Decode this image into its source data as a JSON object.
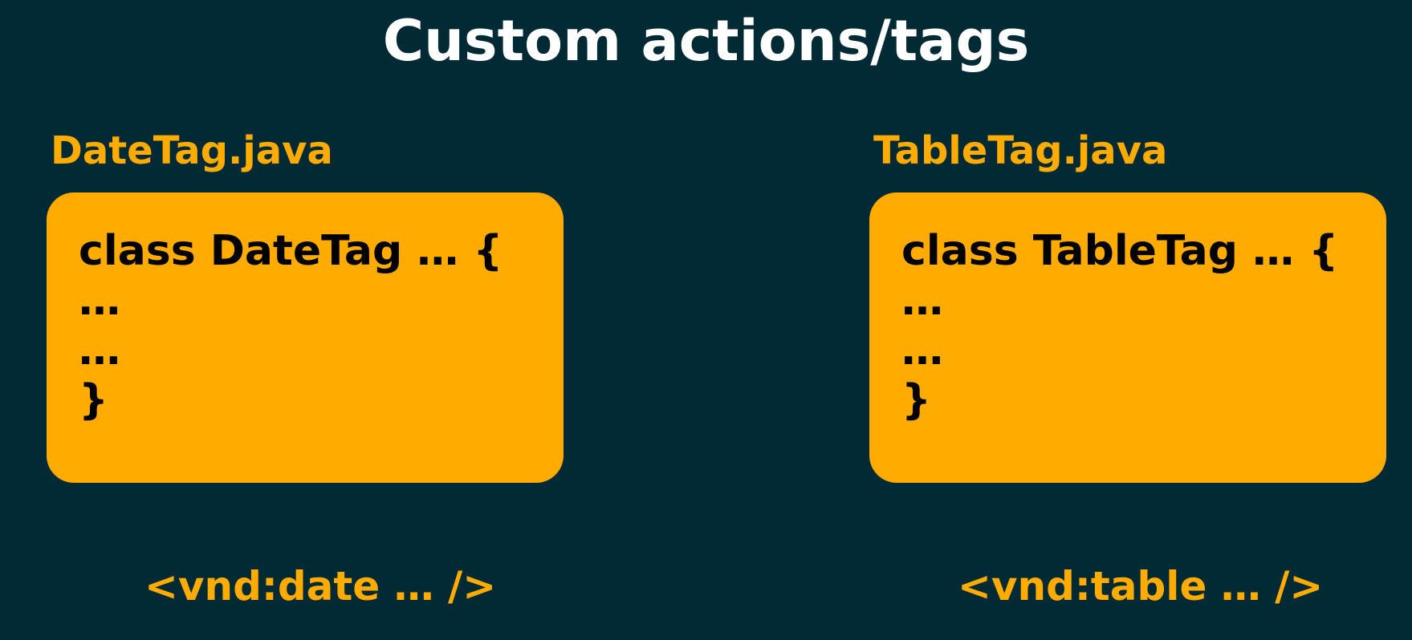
{
  "title": "Custom actions/tags",
  "left": {
    "file_label": "DateTag.java",
    "code_lines": [
      "class DateTag … {",
      "…",
      "…",
      "}"
    ],
    "tag": "<vnd:date … />"
  },
  "right": {
    "file_label": "TableTag.java",
    "code_lines": [
      "class TableTag … {",
      "…",
      "…",
      "}"
    ],
    "tag": "<vnd:table … />"
  },
  "colors": {
    "background": "#022a35",
    "accent": "#ffab00",
    "title_text": "#ffffff",
    "code_text": "#000000"
  }
}
